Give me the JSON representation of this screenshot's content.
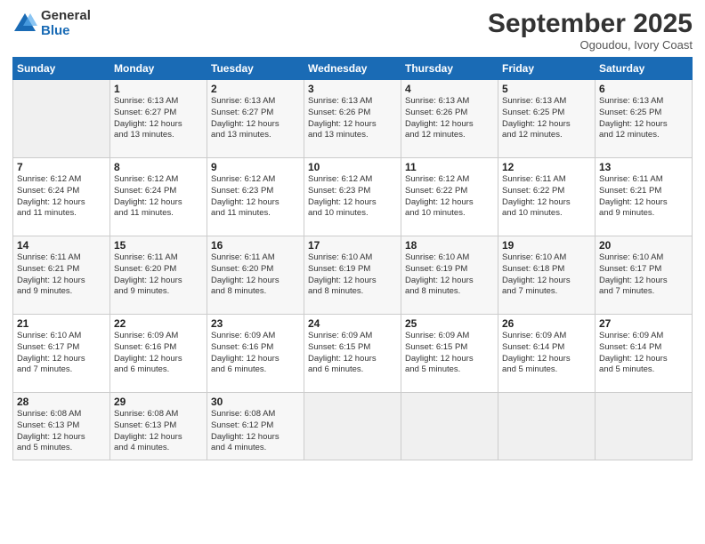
{
  "logo": {
    "general": "General",
    "blue": "Blue"
  },
  "title": "September 2025",
  "location": "Ogoudou, Ivory Coast",
  "days_header": [
    "Sunday",
    "Monday",
    "Tuesday",
    "Wednesday",
    "Thursday",
    "Friday",
    "Saturday"
  ],
  "weeks": [
    [
      {
        "num": "",
        "info": ""
      },
      {
        "num": "1",
        "info": "Sunrise: 6:13 AM\nSunset: 6:27 PM\nDaylight: 12 hours\nand 13 minutes."
      },
      {
        "num": "2",
        "info": "Sunrise: 6:13 AM\nSunset: 6:27 PM\nDaylight: 12 hours\nand 13 minutes."
      },
      {
        "num": "3",
        "info": "Sunrise: 6:13 AM\nSunset: 6:26 PM\nDaylight: 12 hours\nand 13 minutes."
      },
      {
        "num": "4",
        "info": "Sunrise: 6:13 AM\nSunset: 6:26 PM\nDaylight: 12 hours\nand 12 minutes."
      },
      {
        "num": "5",
        "info": "Sunrise: 6:13 AM\nSunset: 6:25 PM\nDaylight: 12 hours\nand 12 minutes."
      },
      {
        "num": "6",
        "info": "Sunrise: 6:13 AM\nSunset: 6:25 PM\nDaylight: 12 hours\nand 12 minutes."
      }
    ],
    [
      {
        "num": "7",
        "info": "Sunrise: 6:12 AM\nSunset: 6:24 PM\nDaylight: 12 hours\nand 11 minutes."
      },
      {
        "num": "8",
        "info": "Sunrise: 6:12 AM\nSunset: 6:24 PM\nDaylight: 12 hours\nand 11 minutes."
      },
      {
        "num": "9",
        "info": "Sunrise: 6:12 AM\nSunset: 6:23 PM\nDaylight: 12 hours\nand 11 minutes."
      },
      {
        "num": "10",
        "info": "Sunrise: 6:12 AM\nSunset: 6:23 PM\nDaylight: 12 hours\nand 10 minutes."
      },
      {
        "num": "11",
        "info": "Sunrise: 6:12 AM\nSunset: 6:22 PM\nDaylight: 12 hours\nand 10 minutes."
      },
      {
        "num": "12",
        "info": "Sunrise: 6:11 AM\nSunset: 6:22 PM\nDaylight: 12 hours\nand 10 minutes."
      },
      {
        "num": "13",
        "info": "Sunrise: 6:11 AM\nSunset: 6:21 PM\nDaylight: 12 hours\nand 9 minutes."
      }
    ],
    [
      {
        "num": "14",
        "info": "Sunrise: 6:11 AM\nSunset: 6:21 PM\nDaylight: 12 hours\nand 9 minutes."
      },
      {
        "num": "15",
        "info": "Sunrise: 6:11 AM\nSunset: 6:20 PM\nDaylight: 12 hours\nand 9 minutes."
      },
      {
        "num": "16",
        "info": "Sunrise: 6:11 AM\nSunset: 6:20 PM\nDaylight: 12 hours\nand 8 minutes."
      },
      {
        "num": "17",
        "info": "Sunrise: 6:10 AM\nSunset: 6:19 PM\nDaylight: 12 hours\nand 8 minutes."
      },
      {
        "num": "18",
        "info": "Sunrise: 6:10 AM\nSunset: 6:19 PM\nDaylight: 12 hours\nand 8 minutes."
      },
      {
        "num": "19",
        "info": "Sunrise: 6:10 AM\nSunset: 6:18 PM\nDaylight: 12 hours\nand 7 minutes."
      },
      {
        "num": "20",
        "info": "Sunrise: 6:10 AM\nSunset: 6:17 PM\nDaylight: 12 hours\nand 7 minutes."
      }
    ],
    [
      {
        "num": "21",
        "info": "Sunrise: 6:10 AM\nSunset: 6:17 PM\nDaylight: 12 hours\nand 7 minutes."
      },
      {
        "num": "22",
        "info": "Sunrise: 6:09 AM\nSunset: 6:16 PM\nDaylight: 12 hours\nand 6 minutes."
      },
      {
        "num": "23",
        "info": "Sunrise: 6:09 AM\nSunset: 6:16 PM\nDaylight: 12 hours\nand 6 minutes."
      },
      {
        "num": "24",
        "info": "Sunrise: 6:09 AM\nSunset: 6:15 PM\nDaylight: 12 hours\nand 6 minutes."
      },
      {
        "num": "25",
        "info": "Sunrise: 6:09 AM\nSunset: 6:15 PM\nDaylight: 12 hours\nand 5 minutes."
      },
      {
        "num": "26",
        "info": "Sunrise: 6:09 AM\nSunset: 6:14 PM\nDaylight: 12 hours\nand 5 minutes."
      },
      {
        "num": "27",
        "info": "Sunrise: 6:09 AM\nSunset: 6:14 PM\nDaylight: 12 hours\nand 5 minutes."
      }
    ],
    [
      {
        "num": "28",
        "info": "Sunrise: 6:08 AM\nSunset: 6:13 PM\nDaylight: 12 hours\nand 5 minutes."
      },
      {
        "num": "29",
        "info": "Sunrise: 6:08 AM\nSunset: 6:13 PM\nDaylight: 12 hours\nand 4 minutes."
      },
      {
        "num": "30",
        "info": "Sunrise: 6:08 AM\nSunset: 6:12 PM\nDaylight: 12 hours\nand 4 minutes."
      },
      {
        "num": "",
        "info": ""
      },
      {
        "num": "",
        "info": ""
      },
      {
        "num": "",
        "info": ""
      },
      {
        "num": "",
        "info": ""
      }
    ]
  ]
}
